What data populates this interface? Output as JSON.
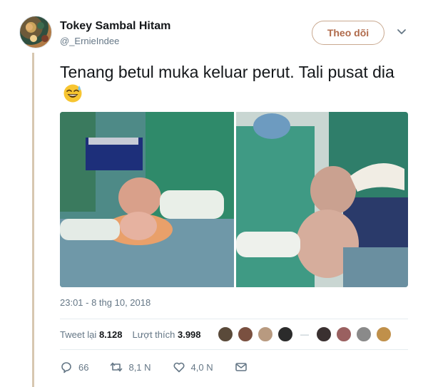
{
  "author": {
    "display_name": "Tokey Sambal Hitam",
    "handle": "@_ErnieIndee"
  },
  "follow_button": {
    "label": "Theo dõi"
  },
  "tweet": {
    "text": "Tenang betul muka keluar perut. Tali pusat dia",
    "emoji": "grinning-face-with-sweat",
    "timestamp": "23:01 - 8 thg 10, 2018"
  },
  "stats": {
    "retweets_label": "Tweet lại",
    "retweets_value": "8.128",
    "likes_label": "Lượt thích",
    "likes_value": "3.998"
  },
  "actions": {
    "reply_count": "66",
    "retweet_count": "8,1 N",
    "like_count": "4,0 N"
  },
  "colors": {
    "accent_follow": "#b06a4a",
    "muted_text": "#657786",
    "thread_line": "#d7c7b0"
  }
}
